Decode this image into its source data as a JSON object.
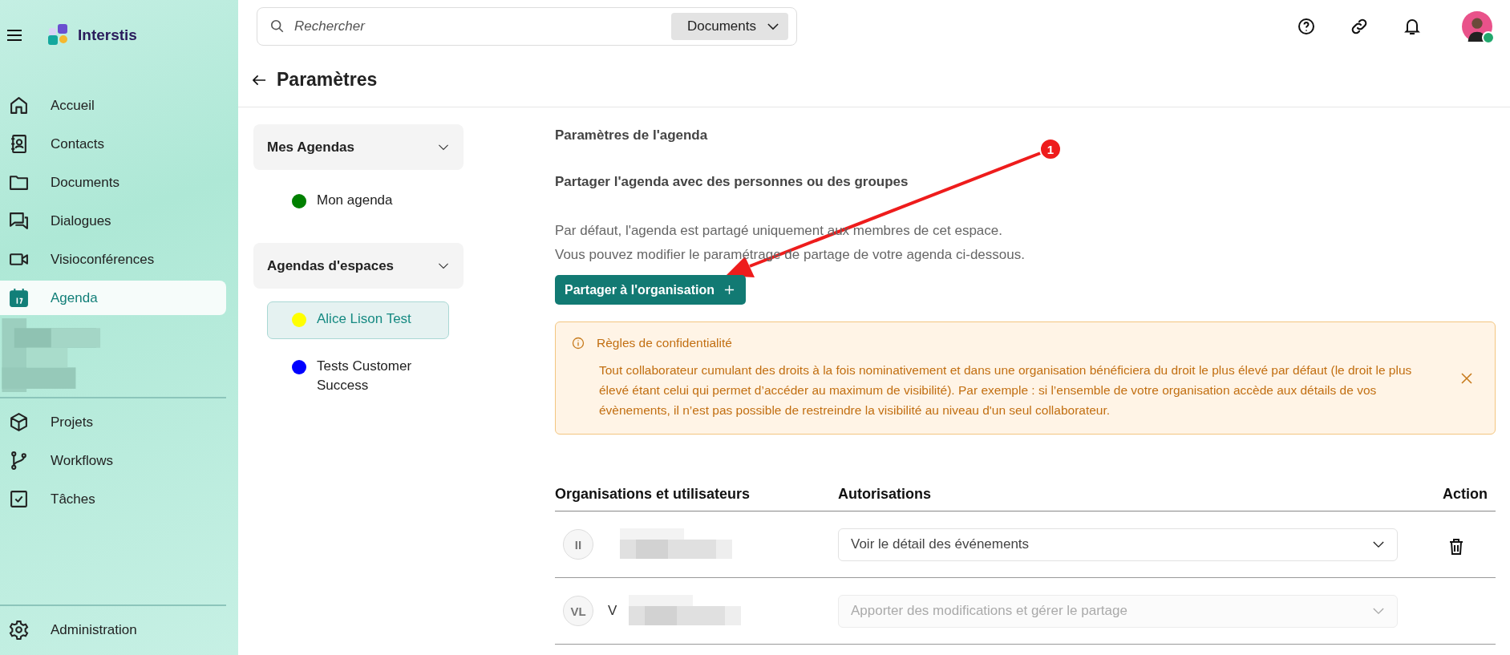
{
  "sidebar": {
    "brand": "Interstis",
    "items": [
      {
        "kind": "home",
        "label": "Accueil",
        "selected": false
      },
      {
        "kind": "contacts",
        "label": "Contacts",
        "selected": false
      },
      {
        "kind": "folder",
        "label": "Documents",
        "selected": false
      },
      {
        "kind": "chat",
        "label": "Dialogues",
        "selected": false
      },
      {
        "kind": "video",
        "label": "Visioconférences",
        "selected": false
      },
      {
        "kind": "calendar",
        "label": "Agenda",
        "selected": true
      }
    ],
    "items_2": [
      {
        "kind": "cube",
        "label": "Projets",
        "selected": false
      },
      {
        "kind": "branch",
        "label": "Workflows",
        "selected": false
      },
      {
        "kind": "check",
        "label": "Tâches",
        "selected": false
      }
    ],
    "footer": {
      "kind": "gear",
      "label": "Administration",
      "selected": false
    }
  },
  "topbar": {
    "search": {
      "placeholder": "Rechercher",
      "scope": "Documents"
    },
    "avatar": {
      "online": true
    }
  },
  "header": {
    "title": "Paramètres"
  },
  "agenda_panel": {
    "groups": [
      {
        "title": "Mes Agendas",
        "items": [
          {
            "label": "Mon agenda",
            "color": "#008000",
            "selected": false
          }
        ]
      },
      {
        "title": "Agendas d'espaces",
        "items": [
          {
            "label": "Alice Lison Test",
            "color": "#ffff00",
            "selected": true
          },
          {
            "label": "Tests Customer Success",
            "color": "#0000ff",
            "selected": false
          }
        ]
      }
    ]
  },
  "settings": {
    "title": "Paramètres de l'agenda",
    "subtitle": "Partager l'agenda avec des personnes ou des groupes",
    "description": [
      "Par défaut, l'agenda est partagé uniquement aux membres de cet espace.",
      "Vous pouvez modifier le paramétrage de partage de votre agenda ci-dessous."
    ],
    "share_button": "Partager à l'organisation",
    "alert": {
      "title": "Règles de confidentialité",
      "text": "Tout collaborateur cumulant des droits à la fois nominativement et dans une organisation bénéficiera du droit le plus élevé par défaut (le droit le plus élevé étant celui qui permet d’accéder au maximum de visibilité). Par exemple : si l’ensemble de votre organisation accède aux détails de vos évènements, il n’est pas possible de restreindre la visibilité au niveau d'un seul collaborateur."
    },
    "table": {
      "columns": [
        "Organisations et utilisateurs",
        "Autorisations",
        "Action"
      ],
      "rows": [
        {
          "initials": "II",
          "permission": "Voir le détail des événements",
          "disabled": false,
          "deletable": true
        },
        {
          "initials": "VL",
          "name": "V",
          "permission": "Apporter des modifications et gérer le partage",
          "disabled": true,
          "deletable": false
        }
      ]
    }
  },
  "annotation": {
    "number": "1"
  }
}
